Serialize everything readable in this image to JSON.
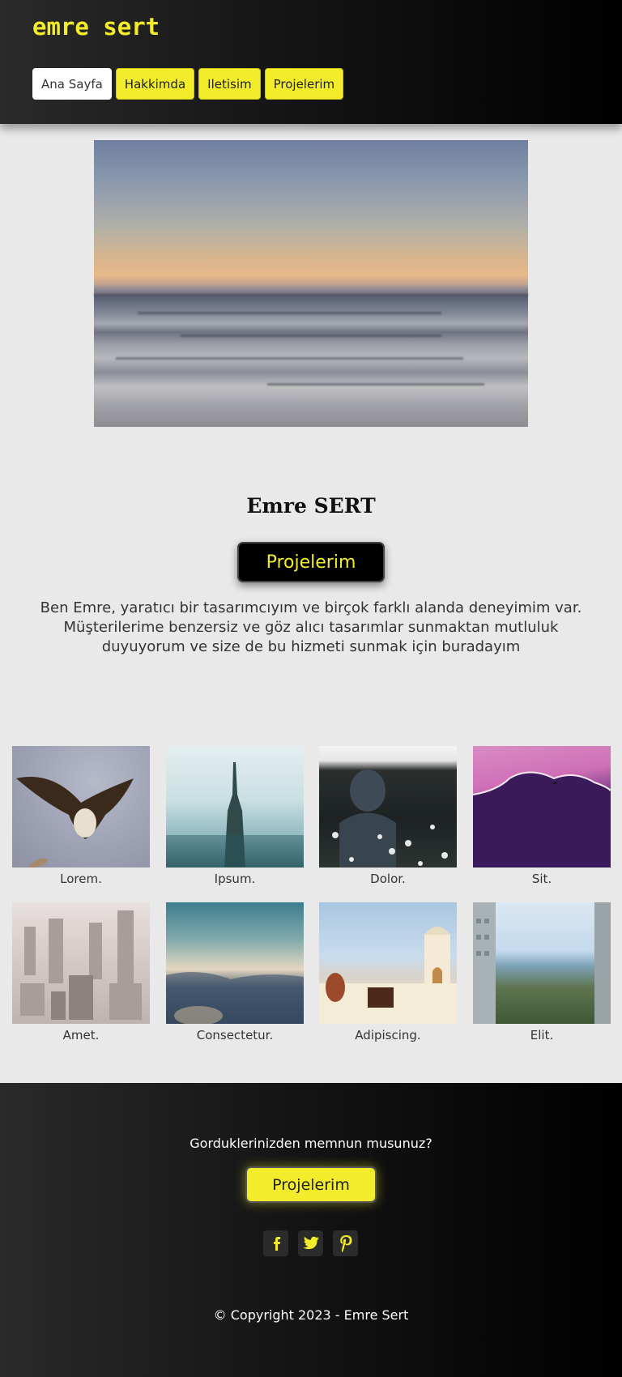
{
  "header": {
    "brand": "emre sert",
    "nav": [
      {
        "label": "Ana Sayfa",
        "active": true
      },
      {
        "label": "Hakkimda",
        "active": false
      },
      {
        "label": "Iletisim",
        "active": false
      },
      {
        "label": "Projelerim",
        "active": false
      }
    ]
  },
  "hero": {
    "image_icon": "sunset-sea-photo",
    "name": "Emre SERT",
    "cta_label": "Projelerim",
    "intro": "Ben Emre, yaratıcı bir tasarımcıyım ve birçok farklı alanda deneyimim var. Müşterilerime benzersiz ve göz alıcı tasarımlar sunmaktan mutluluk duyuyorum ve size de bu hizmeti sunmak için buradayım"
  },
  "gallery": [
    {
      "caption": "Lorem."
    },
    {
      "caption": "Ipsum."
    },
    {
      "caption": "Dolor."
    },
    {
      "caption": "Sit."
    },
    {
      "caption": "Amet."
    },
    {
      "caption": "Consectetur."
    },
    {
      "caption": "Adipiscing."
    },
    {
      "caption": "Elit."
    }
  ],
  "footer": {
    "question": "Gorduklerinizden memnun musunuz?",
    "cta_label": "Projelerim",
    "socials": [
      "facebook-icon",
      "twitter-icon",
      "pinterest-icon"
    ],
    "copyright": "© Copyright 2023 - Emre Sert"
  },
  "colors": {
    "accent": "#f2ec2a",
    "page_bg": "#e9e9e9",
    "dark": "#000000"
  }
}
